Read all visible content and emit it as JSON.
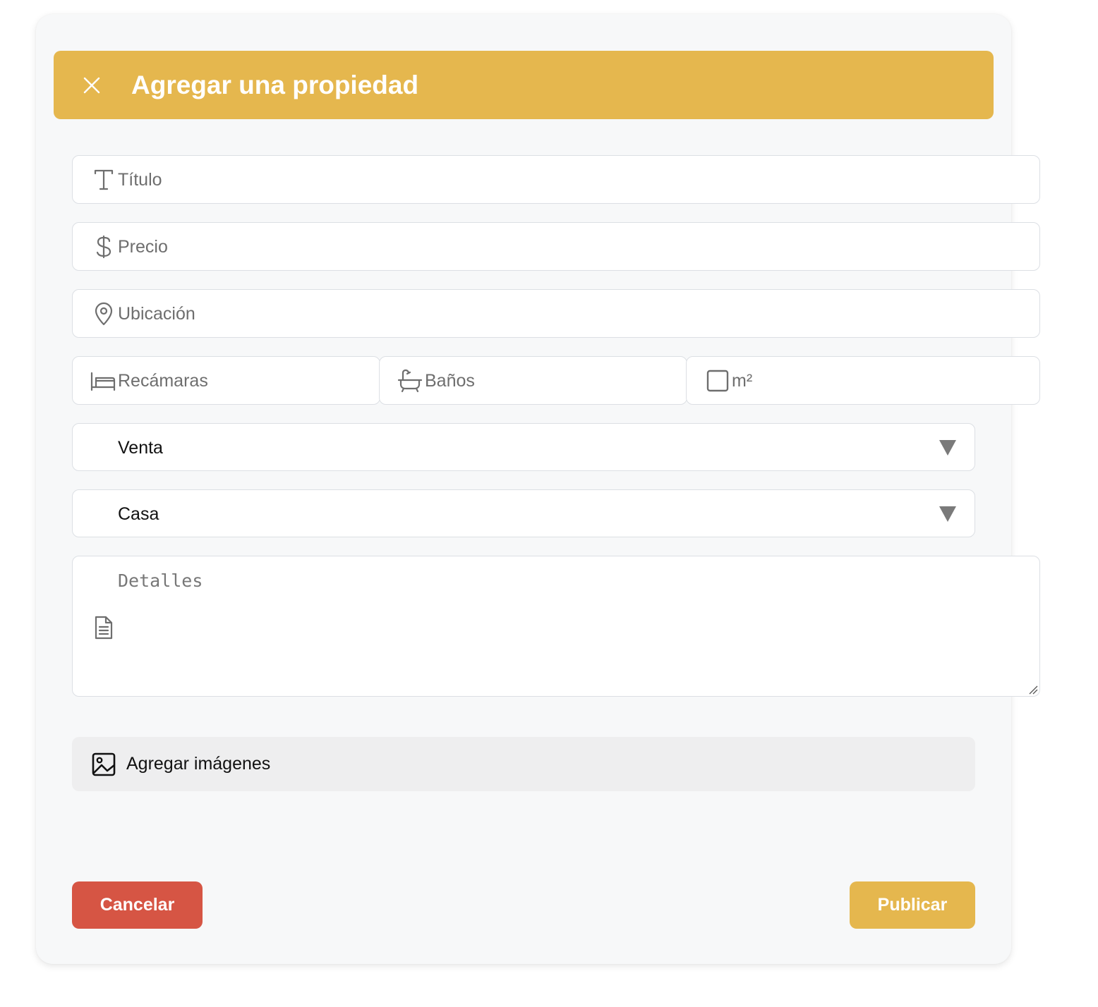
{
  "colors": {
    "accent": "#e5b74e",
    "danger": "#d65544",
    "modal_background": "#f7f8f9",
    "field_background": "#ffffff",
    "field_border": "#dcdfe4",
    "upload_background": "#eeeeef"
  },
  "header": {
    "close_icon": "close-icon",
    "title": "Agregar una propiedad"
  },
  "form": {
    "title_field": {
      "icon": "text-icon",
      "placeholder": "Título"
    },
    "price_field": {
      "icon": "dollar-icon",
      "placeholder": "Precio"
    },
    "location_field": {
      "icon": "map-pin-icon",
      "placeholder": "Ubicación"
    },
    "bedrooms_field": {
      "icon": "bed-icon",
      "placeholder": "Recámaras"
    },
    "bathrooms_field": {
      "icon": "bathtub-icon",
      "placeholder": "Baños"
    },
    "area_field": {
      "icon": "square-icon",
      "placeholder": "m²"
    },
    "operation_select": {
      "value": "Venta"
    },
    "property_type_select": {
      "value": "Casa"
    },
    "details_field": {
      "icon": "document-icon",
      "placeholder": "Detalles"
    },
    "upload": {
      "icon": "image-icon",
      "label": "Agregar imágenes"
    }
  },
  "footer": {
    "cancel_label": "Cancelar",
    "publish_label": "Publicar"
  }
}
